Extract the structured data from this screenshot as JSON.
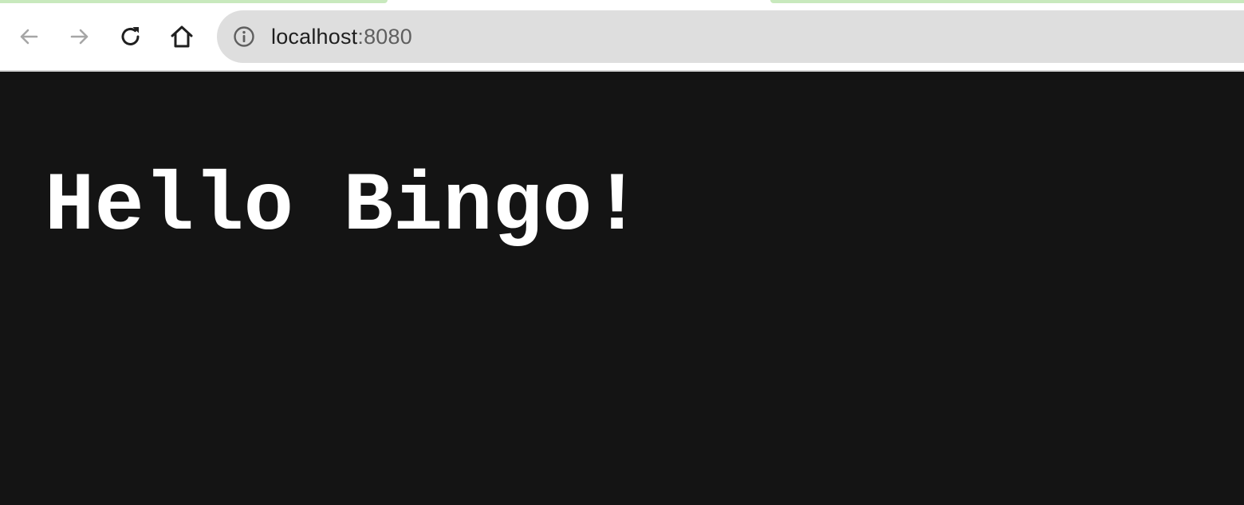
{
  "browser": {
    "address_bar": {
      "host": "localhost",
      "port": ":8080"
    },
    "icons": {
      "back": "arrow-left-icon",
      "forward": "arrow-right-icon",
      "reload": "reload-icon",
      "home": "home-icon",
      "site_info": "info-icon"
    },
    "colors": {
      "tab_accent": "#c8e9bd",
      "omnibox_bg": "#dedede"
    }
  },
  "page": {
    "heading": "Hello Bingo!",
    "background": "#141414",
    "text_color": "#ffffff"
  }
}
